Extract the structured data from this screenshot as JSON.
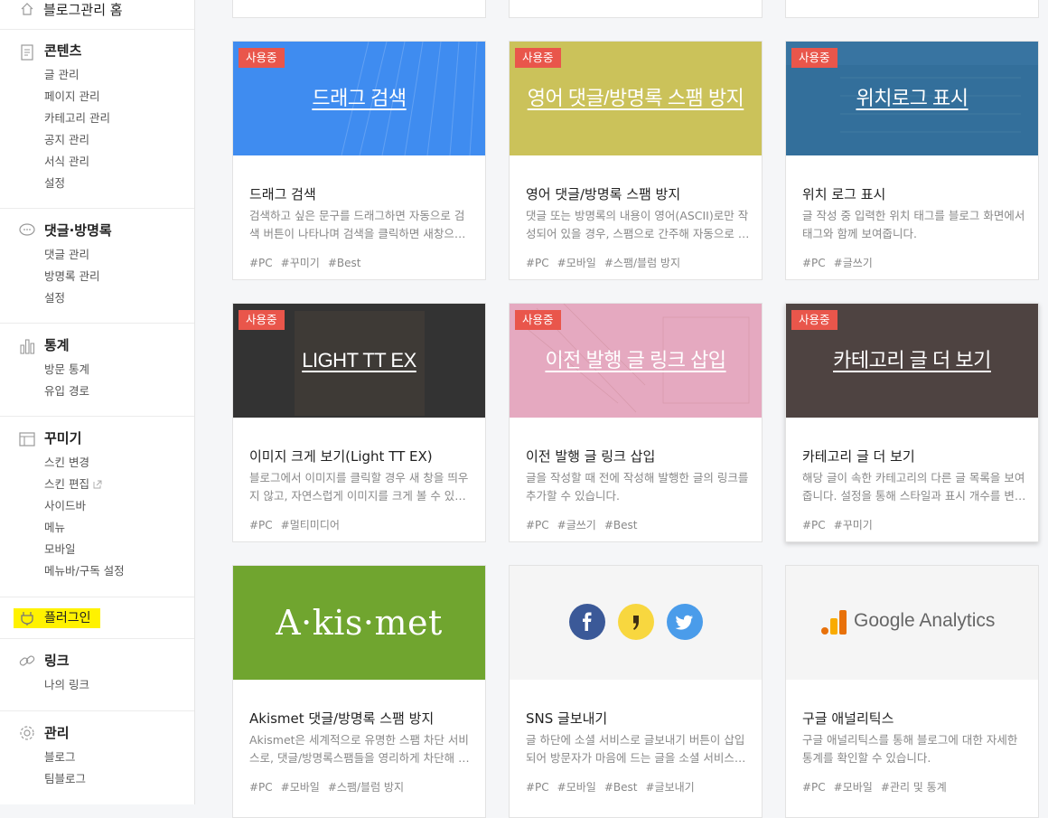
{
  "sidebar": {
    "home_label": "블로그관리 홈",
    "sections": [
      {
        "title": "콘텐츠",
        "items": [
          "글 관리",
          "페이지 관리",
          "카테고리 관리",
          "공지 관리",
          "서식 관리",
          "설정"
        ]
      },
      {
        "title": "댓글·방명록",
        "items": [
          "댓글 관리",
          "방명록 관리",
          "설정"
        ]
      },
      {
        "title": "통계",
        "items": [
          "방문 통계",
          "유입 경로"
        ]
      },
      {
        "title": "꾸미기",
        "items": [
          "스킨 변경",
          "스킨 편집",
          "사이드바",
          "메뉴",
          "모바일",
          "메뉴바/구독 설정"
        ]
      },
      {
        "title": "플러그인",
        "items": []
      },
      {
        "title": "링크",
        "items": [
          "나의 링크"
        ]
      },
      {
        "title": "관리",
        "items": [
          "블로그",
          "팀블로그"
        ]
      }
    ]
  },
  "badge_label": "사용중",
  "cards": [
    {
      "thumb_title": "드래그 검색",
      "title": "드래그 검색",
      "desc": [
        "검색하고 싶은 문구를 드래그하면 자동으로 검",
        "색 버튼이 나타나며 검색을 클릭하면 새창으로 검색 결과를 볼 수 있습니다."
      ],
      "tags": [
        "#PC",
        "#꾸미기",
        "#Best"
      ]
    },
    {
      "thumb_title": "영어 댓글/방명록 스팸 방지",
      "title": "영어 댓글/방명록 스팸 방지",
      "desc": [
        "댓글 또는 방명록의 내용이 영어(ASCII)로만 작",
        "성되어 있을 경우, 스팸으로 간주해 자동으로 차단합니다."
      ],
      "tags": [
        "#PC",
        "#모바일",
        "#스팸/블럼 방지"
      ]
    },
    {
      "thumb_title": "위치로그 표시",
      "title": "위치 로그 표시",
      "desc": [
        "글 작성 중 입력한 위치 태그를 블로그 화면에서",
        "태그와 함께 보여줍니다."
      ],
      "tags": [
        "#PC",
        "#글쓰기"
      ]
    },
    {
      "thumb_title": "LIGHT TT EX",
      "title": "이미지 크게 보기(Light TT EX)",
      "desc": [
        "블로그에서 이미지를 클릭할 경우 새 창을 띄우",
        "지 않고, 자연스럽게 이미지를 크게 볼 수 있습니다."
      ],
      "tags": [
        "#PC",
        "#멀티미디어"
      ]
    },
    {
      "thumb_title": "이전 발행 글 링크 삽입",
      "title": "이전 발행 글 링크 삽입",
      "desc": [
        "글을 작성할 때 전에 작성해 발행한 글의 링크를",
        "추가할 수 있습니다."
      ],
      "tags": [
        "#PC",
        "#글쓰기",
        "#Best"
      ]
    },
    {
      "thumb_title": "카테고리 글 더 보기",
      "title": "카테고리 글 더 보기",
      "desc": [
        "해당 글이 속한 카테고리의 다른 글 목록을 보여",
        "줍니다. 설정을 통해 스타일과 표시 개수를 변경할 수 있습니다."
      ],
      "tags": [
        "#PC",
        "#꾸미기"
      ]
    },
    {
      "thumb_title": "A·kis·met",
      "title": "Akismet 댓글/방명록 스팸 방지",
      "desc": [
        "Akismet은 세계적으로 유명한 스팸 차단 서비",
        "스로, 댓글/방명록스팸들을 영리하게 차단해 줍니다."
      ],
      "tags": [
        "#PC",
        "#모바일",
        "#스팸/블럼 방지"
      ]
    },
    {
      "thumb_title": "",
      "title": "SNS 글보내기",
      "desc": [
        "글 하단에 소셜 서비스로 글보내기 버튼이 삽입",
        "되어 방문자가 마음에 드는 글을 소셜 서비스로 보낼 수 있습니다."
      ],
      "tags": [
        "#PC",
        "#모바일",
        "#Best",
        "#글보내기"
      ]
    },
    {
      "thumb_title": "Google Analytics",
      "title": "구글 애널리틱스",
      "desc": [
        "구글 애널리틱스를 통해 블로그에 대한 자세한",
        "통계를 확인할 수 있습니다."
      ],
      "tags": [
        "#PC",
        "#모바일",
        "#관리 및 통계"
      ]
    }
  ],
  "colors": {
    "badge": "#e9564b",
    "highlight": "#fff200"
  }
}
